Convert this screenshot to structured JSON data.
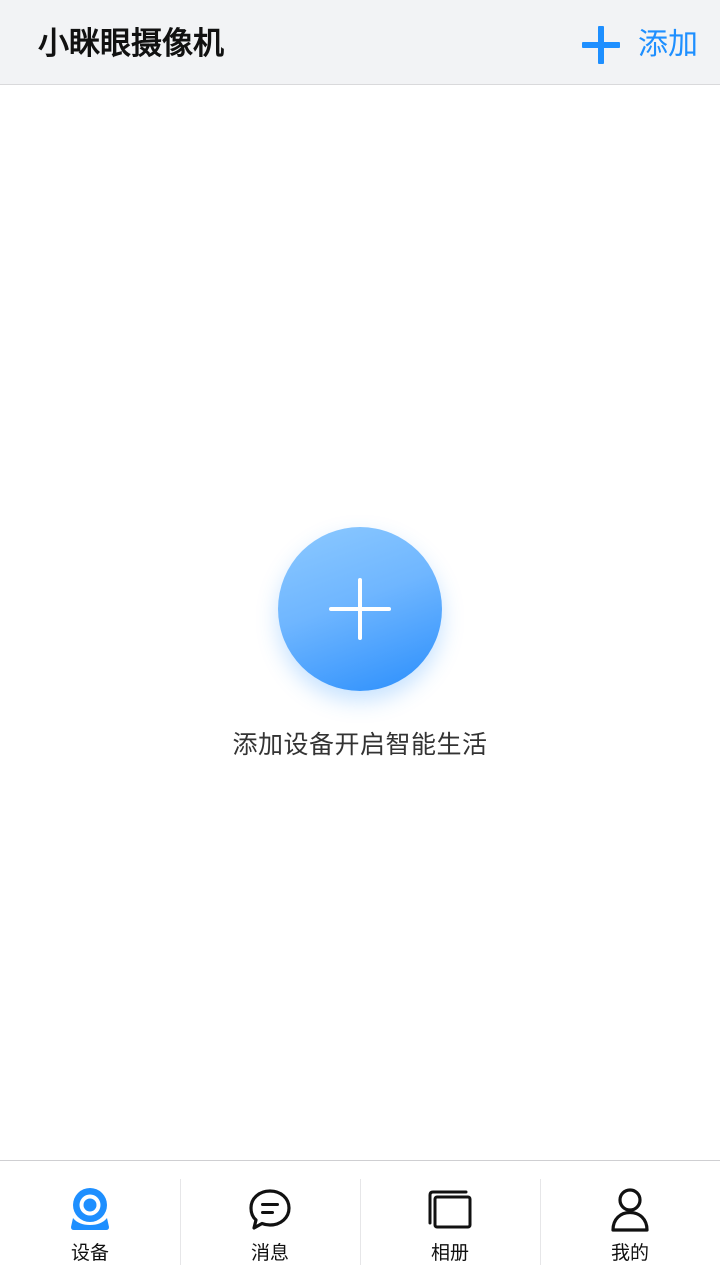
{
  "header": {
    "title": "小眯眼摄像机",
    "add_label": "添加"
  },
  "empty_state": {
    "message": "添加设备开启智能生活"
  },
  "tabbar": {
    "tabs": [
      {
        "label": "设备",
        "icon": "camera-icon",
        "active": true
      },
      {
        "label": "消息",
        "icon": "message-icon",
        "active": false
      },
      {
        "label": "相册",
        "icon": "album-icon",
        "active": false
      },
      {
        "label": "我的",
        "icon": "profile-icon",
        "active": false
      }
    ]
  },
  "colors": {
    "accent": "#1e8fff",
    "header_bg": "#f2f3f5",
    "text_primary": "#111111",
    "text_secondary": "#333333"
  }
}
